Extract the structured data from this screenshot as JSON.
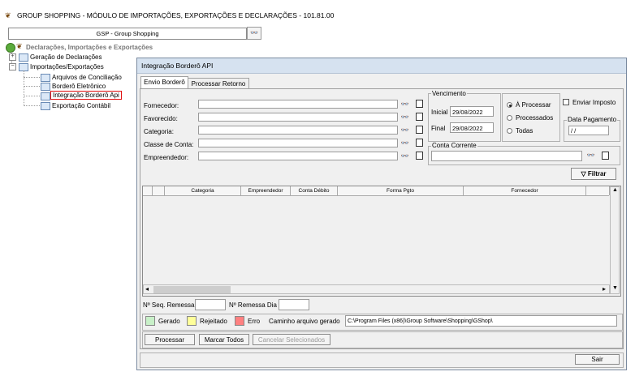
{
  "app": {
    "title": "GROUP SHOPPING - MÓDULO DE IMPORTAÇÕES, EXPORTAÇÕES E DECLARAÇÕES - 101.81.00",
    "company_combo": "GSP - Group Shopping"
  },
  "tree": {
    "root": "Declarações, Importações e Exportações",
    "nodes": [
      {
        "label": "Geração de Declarações"
      },
      {
        "label": "Importações/Exportações"
      },
      {
        "label": "Arquivos de Conciliação"
      },
      {
        "label": "Borderô Eletrônico"
      },
      {
        "label": "Integração Borderô Api"
      },
      {
        "label": "Exportação Contábil"
      }
    ]
  },
  "window": {
    "title": "Integração Borderô API",
    "tabs": [
      "Envio Borderô",
      "Processar Retorno"
    ],
    "filters": {
      "fornecedor": "Fornecedor:",
      "favorecido": "Favorecido:",
      "categoria": "Categoria:",
      "classe_conta": "Classe de Conta:",
      "empreendedor": "Empreendedor:"
    },
    "vencimento": {
      "title": "Vencimento",
      "inicial_label": "Inicial",
      "inicial_value": "29/08/2022",
      "final_label": "Final",
      "final_value": "29/08/2022"
    },
    "status_options": [
      "À Processar",
      "Processados",
      "Todas"
    ],
    "enviar_imposto": "Enviar Imposto",
    "data_pagamento": {
      "title": "Data Pagamento",
      "value": " / /"
    },
    "conta_corrente": {
      "title": "Conta Corrente"
    },
    "filtrar": "Filtrar",
    "grid_columns": [
      "Categoria",
      "Empreendedor",
      "Conta Débito",
      "Forma Pgto",
      "Fornecedor"
    ],
    "seq_remessa": "Nº Seq. Remessa",
    "remessa_dia": "Nº Remessa Dia",
    "legend": [
      {
        "label": "Gerado",
        "color": "#c8f0c8"
      },
      {
        "label": "Rejeitado",
        "color": "#ffff99"
      },
      {
        "label": "Erro",
        "color": "#ff8080"
      }
    ],
    "caminho_label": "Caminho arquivo gerado",
    "caminho_value": "C:\\Program Files (x86)\\Group Software\\Shopping\\GShop\\",
    "buttons": {
      "processar": "Processar",
      "marcar_todos": "Marcar Todos",
      "cancelar": "Cancelar Selecionados",
      "sair": "Sair"
    }
  }
}
